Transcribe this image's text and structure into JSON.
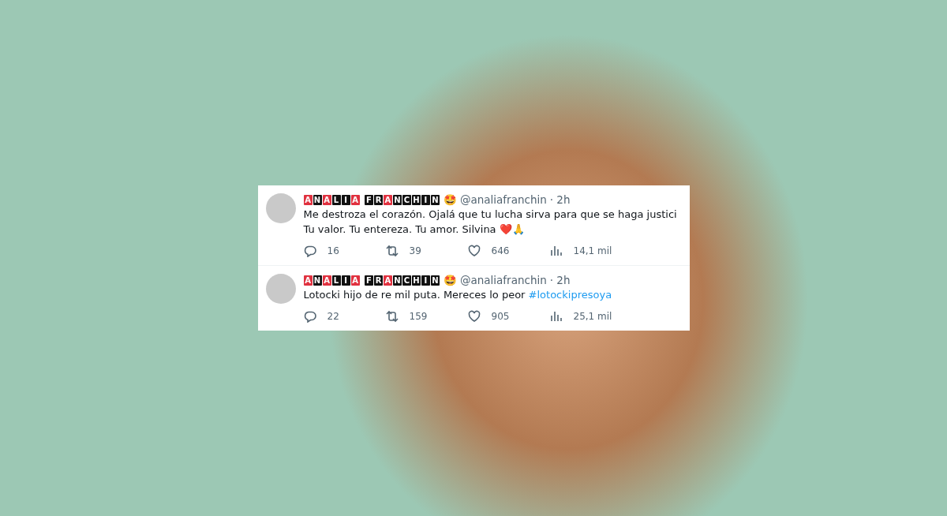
{
  "tweets": [
    {
      "display_name": [
        [
          {
            "letter": "A",
            "color": "#e0313f"
          },
          {
            "letter": "N",
            "color": "#111111"
          },
          {
            "letter": "A",
            "color": "#e0313f"
          },
          {
            "letter": "L",
            "color": "#111111"
          },
          {
            "letter": "I",
            "color": "#111111"
          },
          {
            "letter": "A",
            "color": "#e0313f"
          }
        ],
        [
          {
            "letter": "F",
            "color": "#111111"
          },
          {
            "letter": "R",
            "color": "#111111"
          },
          {
            "letter": "A",
            "color": "#e0313f"
          },
          {
            "letter": "N",
            "color": "#111111"
          },
          {
            "letter": "C",
            "color": "#111111"
          },
          {
            "letter": "H",
            "color": "#111111"
          },
          {
            "letter": "I",
            "color": "#111111"
          },
          {
            "letter": "N",
            "color": "#111111"
          }
        ]
      ],
      "name_emoji": "🤩",
      "handle": "@analiafranchin",
      "time": "· 2h",
      "text": "Me destroza el corazón. Ojalá que tu lucha sirva para que se haga justici\nTu valor. Tu entereza. Tu amor. Silvina ❤️🙏",
      "replies": "16",
      "retweets": "39",
      "likes": "646",
      "views": "14,1 mil"
    },
    {
      "display_name": [
        [
          {
            "letter": "A",
            "color": "#e0313f"
          },
          {
            "letter": "N",
            "color": "#111111"
          },
          {
            "letter": "A",
            "color": "#e0313f"
          },
          {
            "letter": "L",
            "color": "#111111"
          },
          {
            "letter": "I",
            "color": "#111111"
          },
          {
            "letter": "A",
            "color": "#e0313f"
          }
        ],
        [
          {
            "letter": "F",
            "color": "#111111"
          },
          {
            "letter": "R",
            "color": "#111111"
          },
          {
            "letter": "A",
            "color": "#e0313f"
          },
          {
            "letter": "N",
            "color": "#111111"
          },
          {
            "letter": "C",
            "color": "#111111"
          },
          {
            "letter": "H",
            "color": "#111111"
          },
          {
            "letter": "I",
            "color": "#111111"
          },
          {
            "letter": "N",
            "color": "#111111"
          }
        ]
      ],
      "name_emoji": "🤩",
      "handle": "@analiafranchin",
      "time": "· 2h",
      "text": "Lotocki hijo de re mil puta. Mereces lo peor ",
      "hashtag": "#lotockipresoya",
      "replies": "22",
      "retweets": "159",
      "likes": "905",
      "views": "25,1 mil"
    }
  ]
}
